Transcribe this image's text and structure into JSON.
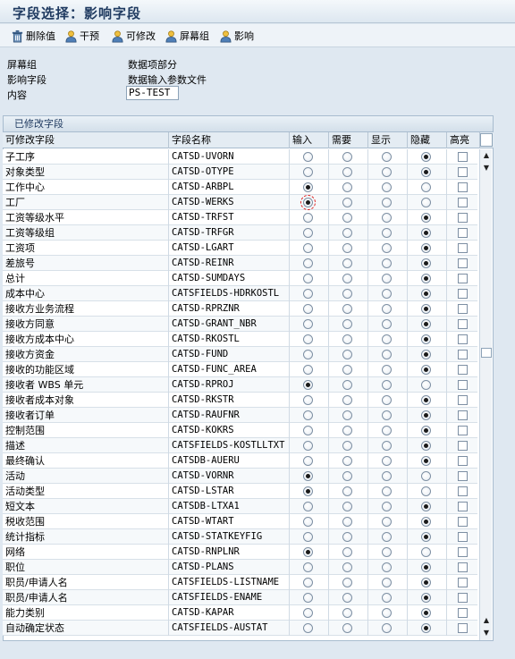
{
  "title": "字段选择：影响字段",
  "toolbar": {
    "delete_label": "删除值",
    "intervene_label": "干预",
    "modifiable_label": "可修改",
    "screen_group_label": "屏幕组",
    "influence_label": "影响"
  },
  "form": {
    "screen_group_label": "屏幕组",
    "screen_group_value": "数据项部分",
    "influence_field_label": "影响字段",
    "influence_field_value": "数据输入参数文件",
    "content_label": "内容",
    "content_value": "PS-TEST"
  },
  "group": {
    "title": "已修改字段",
    "headers": [
      "可修改字段",
      "字段名称",
      "输入",
      "需要",
      "显示",
      "隐藏",
      "高亮"
    ]
  },
  "rows": [
    {
      "name": "子工序",
      "field": "CATSD-UVORN",
      "sel": 3,
      "hl": false
    },
    {
      "name": "对象类型",
      "field": "CATSD-OTYPE",
      "sel": 3,
      "hl": false
    },
    {
      "name": "工作中心",
      "field": "CATSD-ARBPL",
      "sel": 0,
      "hl": false
    },
    {
      "name": "工厂",
      "field": "CATSD-WERKS",
      "sel": 0,
      "hl": false
    },
    {
      "name": "工资等级水平",
      "field": "CATSD-TRFST",
      "sel": 3,
      "hl": false
    },
    {
      "name": "工资等级组",
      "field": "CATSD-TRFGR",
      "sel": 3,
      "hl": false
    },
    {
      "name": "工资项",
      "field": "CATSD-LGART",
      "sel": 3,
      "hl": false
    },
    {
      "name": "差旅号",
      "field": "CATSD-REINR",
      "sel": 3,
      "hl": false
    },
    {
      "name": "总计",
      "field": "CATSD-SUMDAYS",
      "sel": 3,
      "hl": false
    },
    {
      "name": "成本中心",
      "field": "CATSFIELDS-HDRKOSTL",
      "sel": 3,
      "hl": false
    },
    {
      "name": "接收方业务流程",
      "field": "CATSD-RPRZNR",
      "sel": 3,
      "hl": false
    },
    {
      "name": "接收方同意",
      "field": "CATSD-GRANT_NBR",
      "sel": 3,
      "hl": false
    },
    {
      "name": "接收方成本中心",
      "field": "CATSD-RKOSTL",
      "sel": 3,
      "hl": false
    },
    {
      "name": "接收方资金",
      "field": "CATSD-FUND",
      "sel": 3,
      "hl": false
    },
    {
      "name": "接收的功能区域",
      "field": "CATSD-FUNC_AREA",
      "sel": 3,
      "hl": false
    },
    {
      "name": "接收者 WBS 单元",
      "field": "CATSD-RPROJ",
      "sel": 0,
      "hl": false
    },
    {
      "name": "接收者成本对象",
      "field": "CATSD-RKSTR",
      "sel": 3,
      "hl": false
    },
    {
      "name": "接收者订单",
      "field": "CATSD-RAUFNR",
      "sel": 3,
      "hl": false
    },
    {
      "name": "控制范围",
      "field": "CATSD-KOKRS",
      "sel": 3,
      "hl": false
    },
    {
      "name": "描述",
      "field": "CATSFIELDS-KOSTLLTXT",
      "sel": 3,
      "hl": false
    },
    {
      "name": "最终确认",
      "field": "CATSDB-AUERU",
      "sel": 3,
      "hl": false
    },
    {
      "name": "活动",
      "field": "CATSD-VORNR",
      "sel": 0,
      "hl": false
    },
    {
      "name": "活动类型",
      "field": "CATSD-LSTAR",
      "sel": 0,
      "hl": false
    },
    {
      "name": "短文本",
      "field": "CATSDB-LTXA1",
      "sel": 3,
      "hl": false
    },
    {
      "name": "税收范围",
      "field": "CATSD-WTART",
      "sel": 3,
      "hl": false
    },
    {
      "name": "统计指标",
      "field": "CATSD-STATKEYFIG",
      "sel": 3,
      "hl": false
    },
    {
      "name": "网络",
      "field": "CATSD-RNPLNR",
      "sel": 0,
      "hl": false
    },
    {
      "name": "职位",
      "field": "CATSD-PLANS",
      "sel": 3,
      "hl": false
    },
    {
      "name": "职员/申请人名",
      "field": "CATSFIELDS-LISTNAME",
      "sel": 3,
      "hl": false
    },
    {
      "name": "职员/申请人名",
      "field": "CATSFIELDS-ENAME",
      "sel": 3,
      "hl": false
    },
    {
      "name": "能力类别",
      "field": "CATSD-KAPAR",
      "sel": 3,
      "hl": false
    },
    {
      "name": "自动确定状态",
      "field": "CATSFIELDS-AUSTAT",
      "sel": 3,
      "hl": false
    }
  ],
  "icons": {
    "delete": "trash-icon",
    "intervene": "person-icon",
    "modifiable": "person-icon",
    "screen_group": "person-icon",
    "influence": "person-icon",
    "scroll_up": "arrow-up-icon",
    "scroll_down": "arrow-down-icon"
  }
}
